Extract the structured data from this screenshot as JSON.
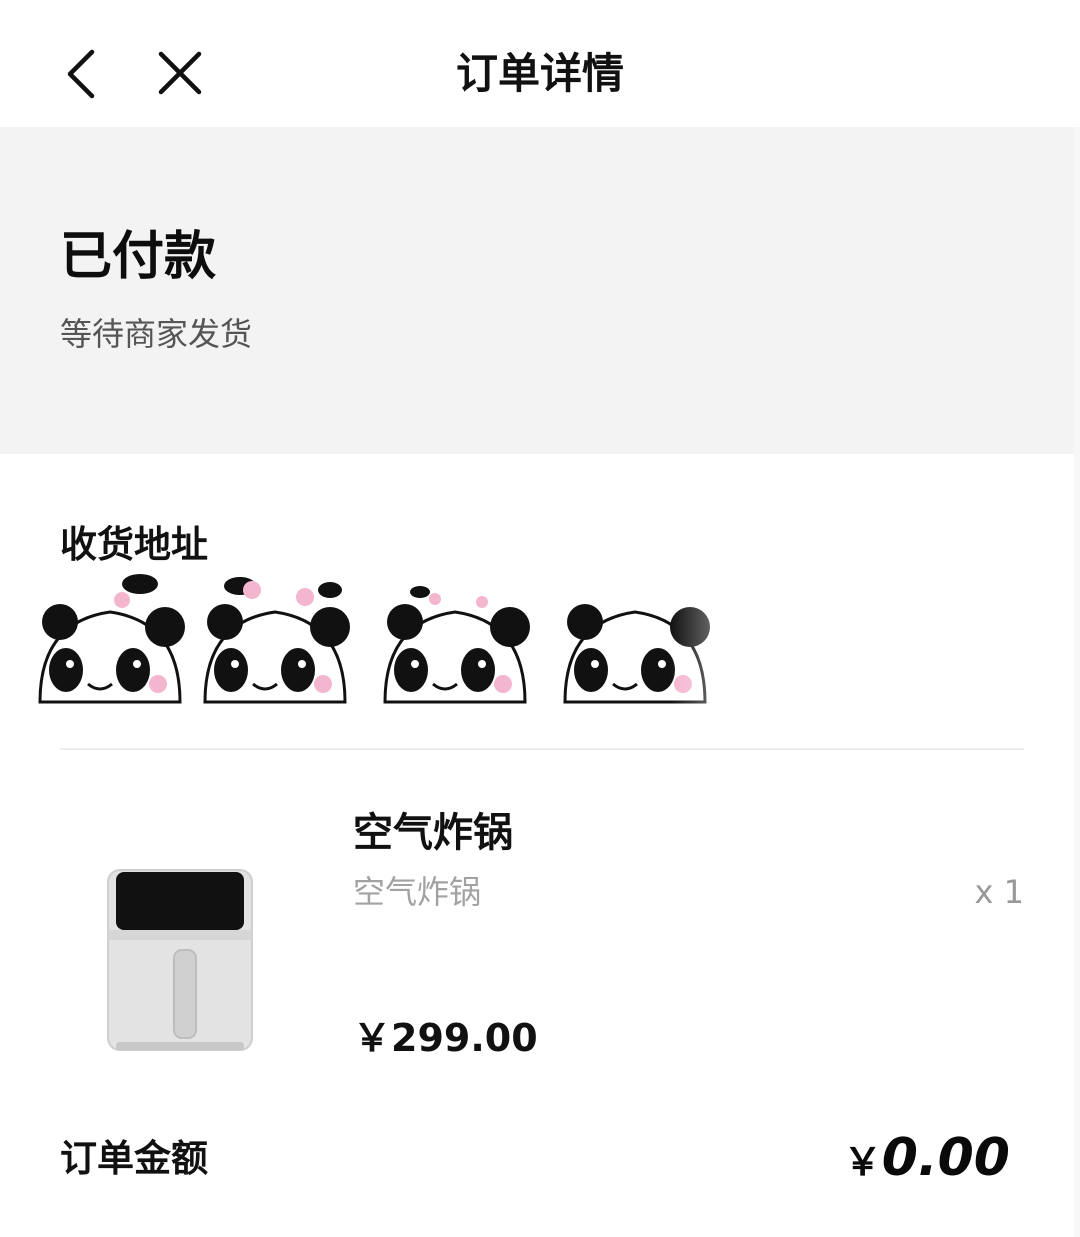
{
  "header": {
    "title": "订单详情",
    "back_icon": "chevron-left-icon",
    "close_icon": "close-icon"
  },
  "status": {
    "title": "已付款",
    "subtitle": "等待商家发货"
  },
  "address": {
    "label": "收货地址"
  },
  "product": {
    "name": "空气炸锅",
    "spec": "空气炸锅",
    "quantity": "x 1",
    "price": "￥299.00"
  },
  "summary": {
    "label": "订单金额",
    "currency": "￥",
    "amount": "0.00"
  },
  "colors": {
    "status_background": "#f3f3f3",
    "divider": "#ececec",
    "secondary_text": "#a2a2a2"
  }
}
